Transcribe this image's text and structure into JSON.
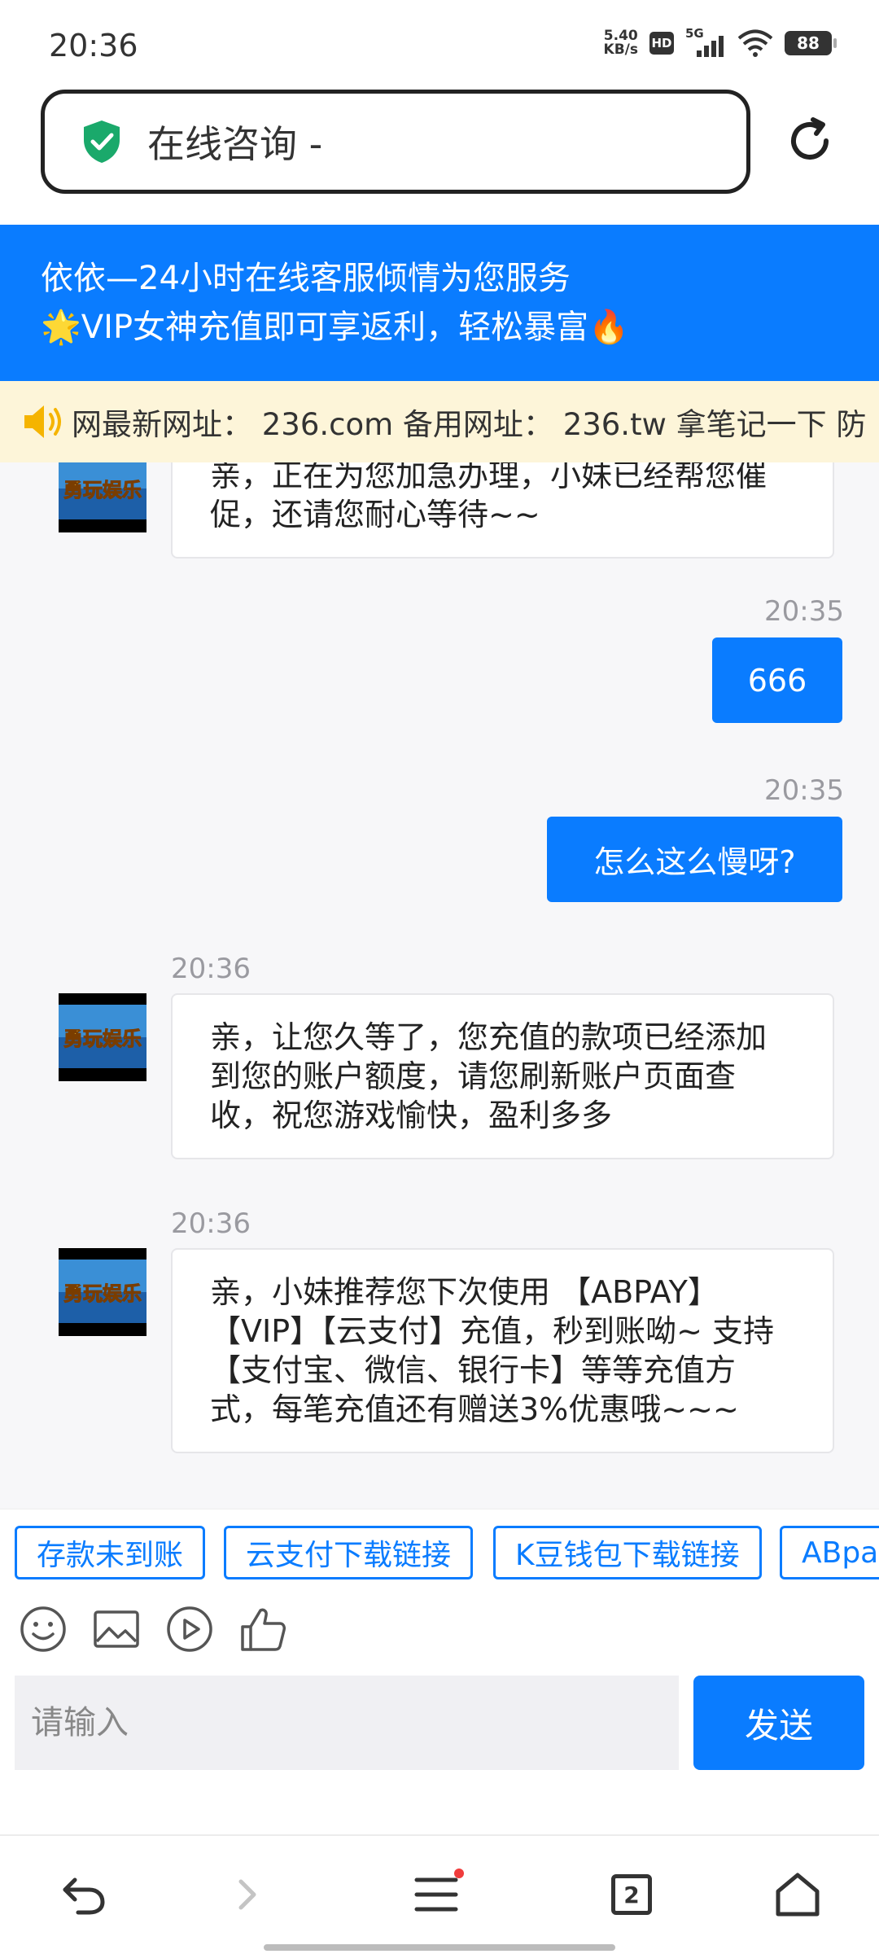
{
  "status_bar": {
    "time": "20:36",
    "net_speed_value": "5.40",
    "net_speed_unit": "KB/s",
    "hd_label": "HD",
    "network_label": "5G",
    "battery": "88"
  },
  "browser": {
    "url_title": "在线咨询 -"
  },
  "header": {
    "line1": "依依—24小时在线客服倾情为您服务",
    "line2": "🌟VIP女神充值即可享返利，轻松暴富🔥"
  },
  "notice": {
    "text": "网最新网址： 236.com 备用网址： 236.tw 拿笔记一下 防"
  },
  "messages": [
    {
      "from": "agent",
      "time": "",
      "text": "亲，正在为您加急办理，小妹已经帮您催促，还请您耐心等待~~"
    },
    {
      "from": "user",
      "time": "20:35",
      "text": "666"
    },
    {
      "from": "user",
      "time": "20:35",
      "text": "怎么这么慢呀?"
    },
    {
      "from": "agent",
      "time": "20:36",
      "text": "亲，让您久等了，您充值的款项已经添加到您的账户额度，请您刷新账户页面查收，祝您游戏愉快，盈利多多"
    },
    {
      "from": "agent",
      "time": "20:36",
      "text": "亲，小妹推荐您下次使用 【ABPAY】【VIP】【云支付】充值，秒到账呦~ 支持【支付宝、微信、银行卡】等等充值方式，每笔充值还有赠送3%优惠哦~~~"
    }
  ],
  "avatar_text": "勇玩娱乐",
  "quick_replies": [
    "存款未到账",
    "云支付下载链接",
    "K豆钱包下载链接",
    "ABpa"
  ],
  "input": {
    "placeholder": "请输入",
    "send_label": "发送"
  },
  "nav": {
    "tab_count": "2"
  },
  "colors": {
    "accent": "#0a7cff",
    "notice_bg": "#fdf5d9",
    "chat_bg": "#f7f7f9"
  }
}
